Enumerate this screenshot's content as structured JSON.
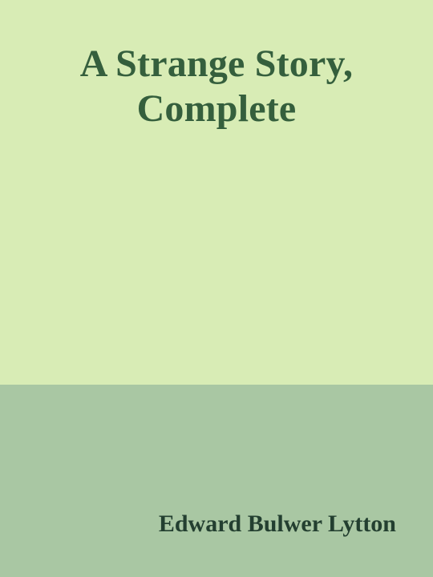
{
  "cover": {
    "title_lines": [
      "A Strange Story,",
      "Complete"
    ],
    "author": "Edward Bulwer Lytton"
  },
  "colors": {
    "top_background": "#d8ecb5",
    "bottom_background": "#a9c7a3",
    "title_text": "#355f3d",
    "author_text": "#233f30"
  }
}
